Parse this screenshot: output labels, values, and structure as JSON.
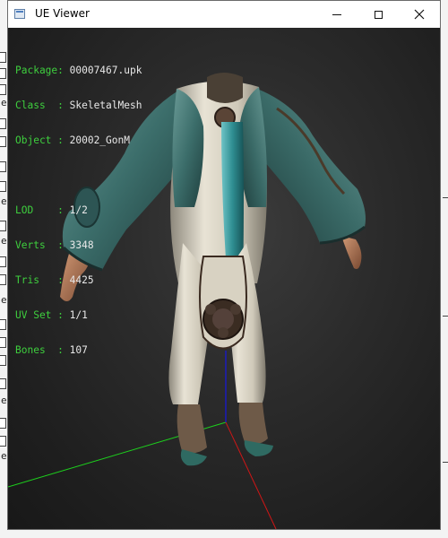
{
  "window": {
    "title": "UE Viewer"
  },
  "info_panel": {
    "package_label": "Package: ",
    "package_value": "00007467.upk",
    "class_label": "Class  : ",
    "class_value": "SkeletalMesh",
    "object_label": "Object : ",
    "object_value": "20002_GonM",
    "lod_label": "LOD    : ",
    "lod_value": "1/2",
    "verts_label": "Verts  : ",
    "verts_value": "3348",
    "tris_label": "Tris   : ",
    "tris_value": "4425",
    "uvset_label": "UV Set : ",
    "uvset_value": "1/1",
    "bones_label": "Bones  : ",
    "bones_value": "107"
  },
  "colors": {
    "label_green": "#3ecf3e",
    "value_white": "#e8e8e8",
    "axis_x": "#d01616",
    "axis_y": "#1dd01d",
    "axis_z": "#1818e0",
    "robe_teal": "#3c6e6b",
    "robe_white": "#d9d3c3"
  },
  "icons": {
    "app": "app-window-icon",
    "minimize": "minimize-icon",
    "maximize": "maximize-icon",
    "close": "close-icon"
  }
}
